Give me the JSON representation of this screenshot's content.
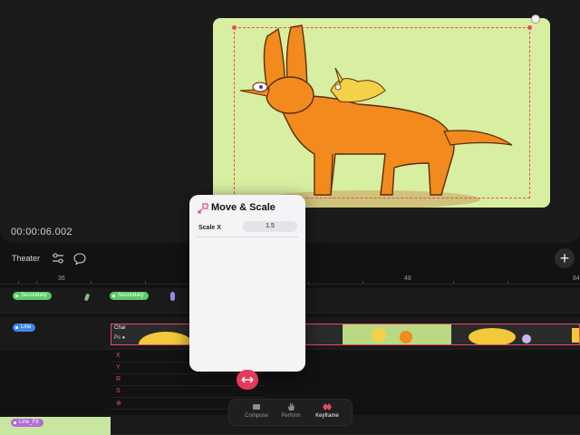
{
  "preview": {
    "timecode": "00:00:06.002"
  },
  "toolbar": {
    "theater_label": "Theater"
  },
  "ruler": {
    "labels": [
      "36",
      "48",
      "84"
    ]
  },
  "tracks": {
    "secondary_label": "Secondary",
    "secondary_label_2": "Secondary",
    "line_label": "Line",
    "char_label": "Char",
    "char_sub": "Ps ●",
    "line_f8_label": "Line_F8"
  },
  "keyframe_rows": {
    "letters": [
      "X",
      "Y",
      "R",
      "S",
      "⊕"
    ]
  },
  "panel": {
    "title": "Move & Scale",
    "prop_label": "Scale X",
    "prop_value": "1.5"
  },
  "tabs": [
    {
      "label": "Compose",
      "icon": "compose-icon"
    },
    {
      "label": "Perform",
      "icon": "perform-hand-icon"
    },
    {
      "label": "Keyframe",
      "icon": "keyframe-icon"
    }
  ],
  "colors": {
    "accent": "#e84a67",
    "canvas_bg": "#d8eea1",
    "character_orange": "#f28a1d",
    "secondary_tag": "#5cc96b",
    "line_tag": "#3d86f0",
    "line_f8_tag": "#b26bd9"
  }
}
